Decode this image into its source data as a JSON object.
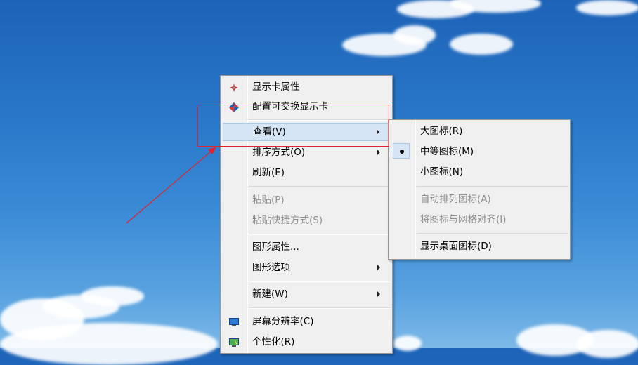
{
  "context_menu": {
    "items": [
      {
        "label": "显示卡属性",
        "icon": "display-card-icon"
      },
      {
        "label": "配置可交换显示卡",
        "icon": "switchable-gpu-icon"
      },
      {
        "label": "查看(V)",
        "submenu": true,
        "highlighted": true
      },
      {
        "label": "排序方式(O)",
        "submenu": true
      },
      {
        "label": "刷新(E)"
      },
      {
        "label": "粘贴(P)",
        "disabled": true
      },
      {
        "label": "粘贴快捷方式(S)",
        "disabled": true
      },
      {
        "label": "图形属性..."
      },
      {
        "label": "图形选项",
        "submenu": true
      },
      {
        "label": "新建(W)",
        "submenu": true
      },
      {
        "label": "屏幕分辨率(C)",
        "icon": "screen-resolution-icon"
      },
      {
        "label": "个性化(R)",
        "icon": "personalize-icon"
      }
    ]
  },
  "view_submenu": {
    "items": [
      {
        "label": "大图标(R)"
      },
      {
        "label": "中等图标(M)",
        "checked": true
      },
      {
        "label": "小图标(N)"
      },
      {
        "label": "自动排列图标(A)",
        "disabled": true
      },
      {
        "label": "将图标与网格对齐(I)",
        "disabled": true
      },
      {
        "label": "显示桌面图标(D)"
      }
    ]
  },
  "colors": {
    "annotation": "#e0232b",
    "highlight": "#d6e5f5",
    "menu_bg": "#f0f0f0"
  }
}
